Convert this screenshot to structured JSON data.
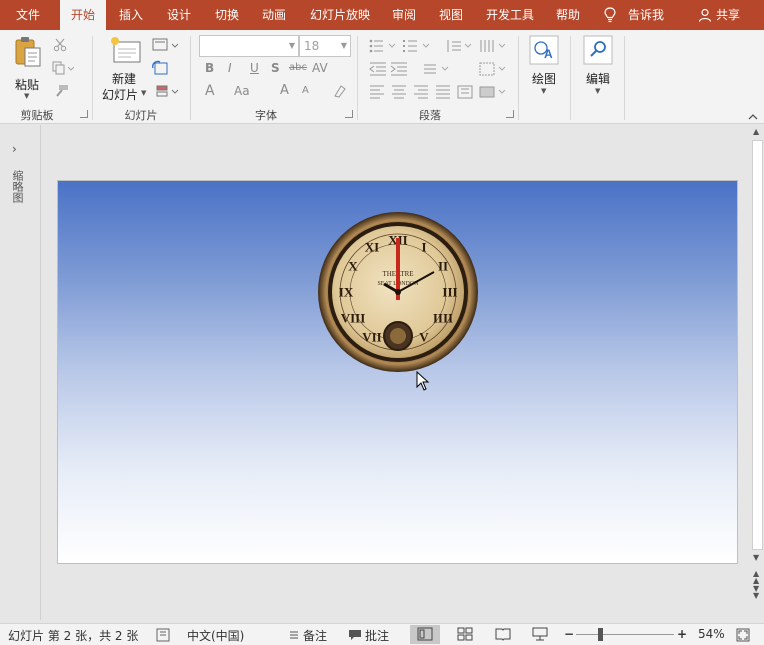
{
  "tabs": [
    "文件",
    "开始",
    "插入",
    "设计",
    "切换",
    "动画",
    "幻灯片放映",
    "审阅",
    "视图",
    "开发工具",
    "帮助",
    "告诉我",
    "共享"
  ],
  "active_tab_index": 1,
  "ribbon": {
    "paste_label": "粘贴",
    "new_slide_label_1": "新建",
    "new_slide_label_2": "幻灯片",
    "draw_label": "绘图",
    "edit_label": "编辑",
    "font_name_value": "",
    "font_size_value": "18",
    "groups": {
      "clipboard": "剪贴板",
      "slides": "幻灯片",
      "font": "字体",
      "paragraph": "段落"
    },
    "font_buttons": [
      "B",
      "I",
      "U",
      "S",
      "abc",
      "AV",
      "A",
      "Aa",
      "A",
      "A"
    ]
  },
  "left_pane": {
    "label": "缩略图"
  },
  "clock": {
    "brand": "THEATRE",
    "brand_sub": "SEAT LONDON"
  },
  "status": {
    "slide_info": "幻灯片 第 2 张，共 2 张",
    "language": "中文(中国)",
    "notes_label": "备注",
    "comments_label": "批注",
    "zoom": "54%"
  },
  "colors": {
    "accent": "#b7472a",
    "ribbon_bg": "#f3f3f3",
    "slide_top": "#4a72c6",
    "slide_bottom": "#ffffff"
  }
}
